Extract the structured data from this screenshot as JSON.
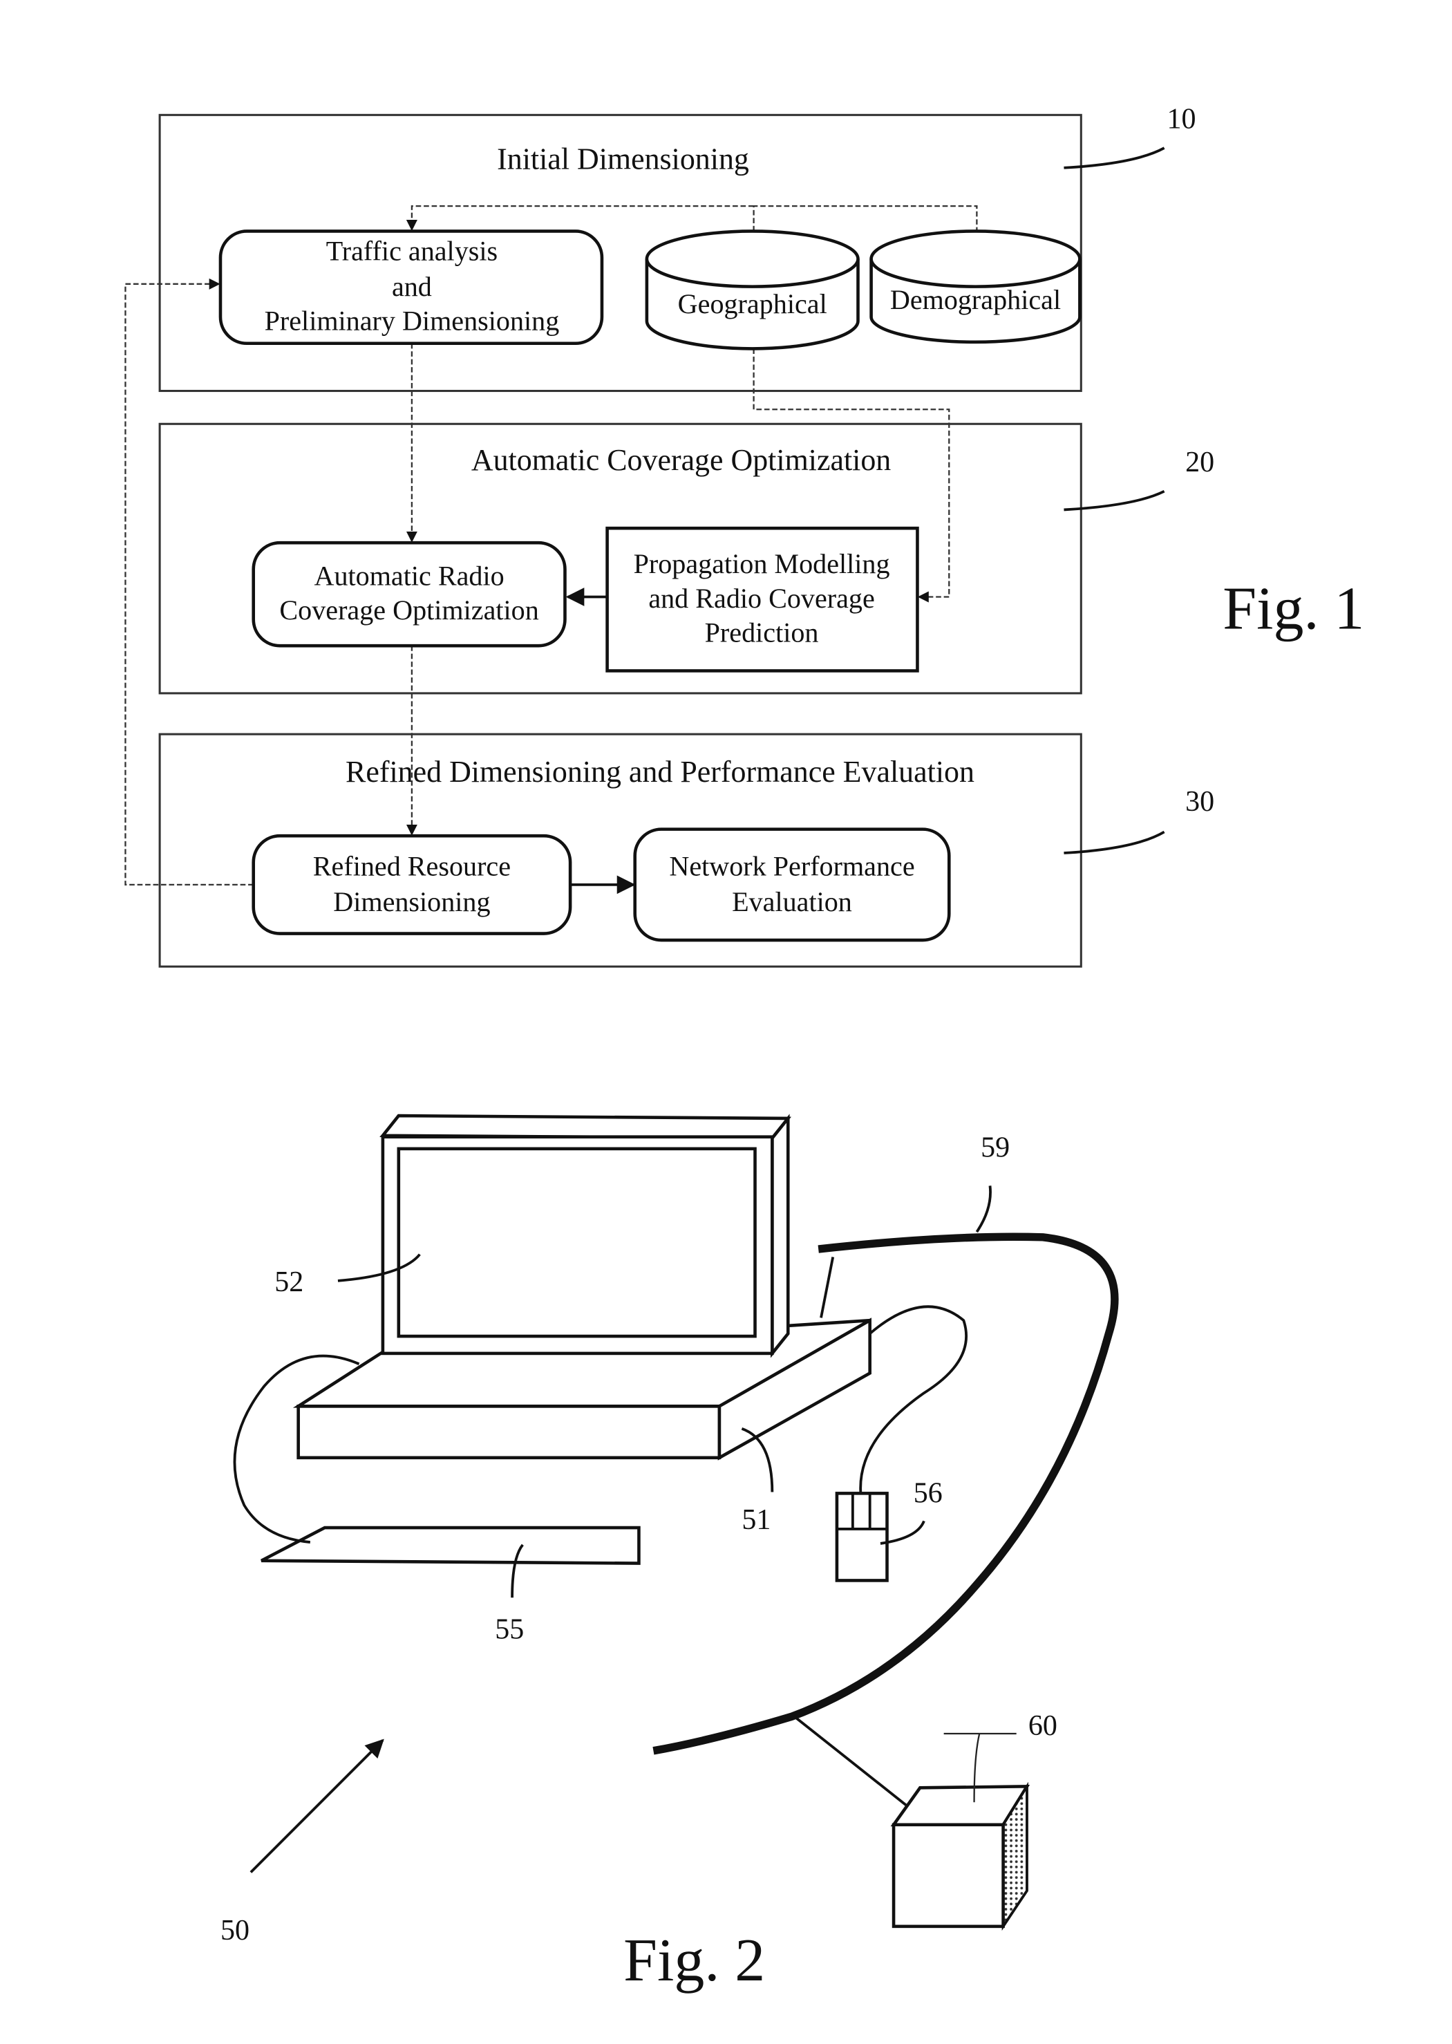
{
  "fig1": {
    "caption": "Fig. 1",
    "sections": [
      {
        "ref": "10",
        "title": "Initial Dimensioning"
      },
      {
        "ref": "20",
        "title": "Automatic Coverage Optimization"
      },
      {
        "ref": "30",
        "title": "Refined Dimensioning and Performance Evaluation"
      }
    ],
    "nodes": {
      "traffic": [
        "Traffic analysis",
        "and",
        "Preliminary Dimensioning"
      ],
      "geographical": "Geographical",
      "demographical": "Demographical",
      "auto_radio": [
        "Automatic Radio",
        "Coverage Optimization"
      ],
      "propagation": [
        "Propagation Modelling",
        "and Radio Coverage",
        "Prediction"
      ],
      "refined_resource": [
        "Refined Resource",
        "Dimensioning"
      ],
      "network_perf": [
        "Network Performance",
        "Evaluation"
      ]
    }
  },
  "fig2": {
    "caption": "Fig. 2",
    "refs": {
      "system": "50",
      "computer": "51",
      "monitor": "52",
      "keyboard": "55",
      "mouse": "56",
      "network": "59",
      "server": "60"
    }
  }
}
